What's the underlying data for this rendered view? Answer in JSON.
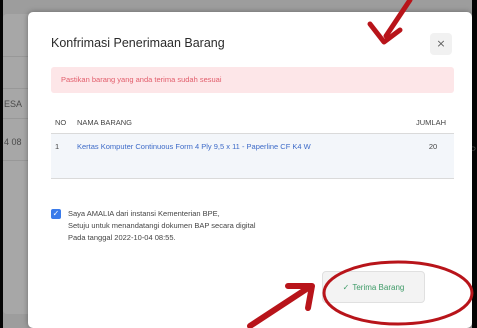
{
  "background": {
    "left_header_fragment": "ESA",
    "left_cell_fragment": "4 08",
    "right_cell_fragment": "P"
  },
  "modal": {
    "title": "Konfrimasi Penerimaan Barang",
    "close_label": "×",
    "alert_text": "Pastikan barang yang anda terima sudah sesuai",
    "table": {
      "headers": {
        "no": "NO",
        "name": "NAMA BARANG",
        "qty": "JUMLAH"
      },
      "rows": [
        {
          "no": "1",
          "name": "Kertas Komputer Continuous Form 4 Ply 9,5 x 11 - Paperline CF K4 W",
          "qty": "20"
        }
      ]
    },
    "consent": {
      "checked": true,
      "line1": "Saya AMALIA dari instansi Kementerian BPE,",
      "line2": "Setuju untuk menandatangi dokumen BAP secara digital",
      "line3": "Pada tanggal 2022-10-04 08:55."
    },
    "accept_button_label": "Terima Barang"
  },
  "colors": {
    "annotation_red": "#b8141a",
    "alert_bg": "#fde6e8",
    "alert_text": "#e25d6b",
    "checkbox_blue": "#3a7bea",
    "accept_green": "#3f9b68"
  },
  "icons": {
    "close": "close-icon",
    "checkbox": "check-icon",
    "accept": "check-icon"
  }
}
